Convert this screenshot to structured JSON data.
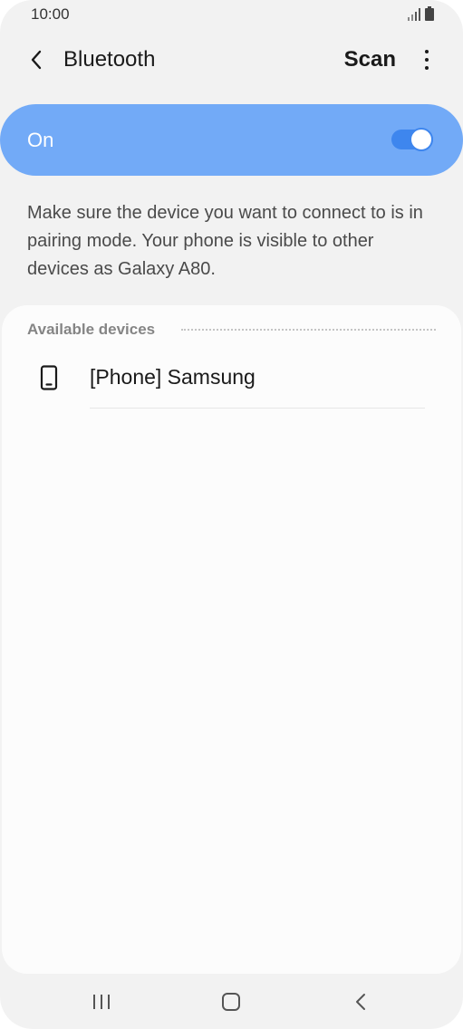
{
  "status_bar": {
    "time": "10:00",
    "icons": [
      "signal-icon",
      "battery-icon"
    ]
  },
  "app_bar": {
    "back_icon": "chevron-left-icon",
    "title": "Bluetooth",
    "scan_label": "Scan",
    "more_icon": "more-vertical-icon"
  },
  "master_switch": {
    "label": "On",
    "enabled": true,
    "background_color": "#72aaf7",
    "toggle_color": "#3e86ee"
  },
  "info_text": "Make sure the device you want to connect to is in pairing mode. Your phone is visible to other devices as Galaxy A80.",
  "available_devices": {
    "header": "Available devices",
    "items": [
      {
        "icon": "phone-icon",
        "name": "[Phone] Samsung"
      }
    ]
  },
  "nav_bar": {
    "icons": [
      "recents-icon",
      "home-icon",
      "back-icon"
    ]
  }
}
